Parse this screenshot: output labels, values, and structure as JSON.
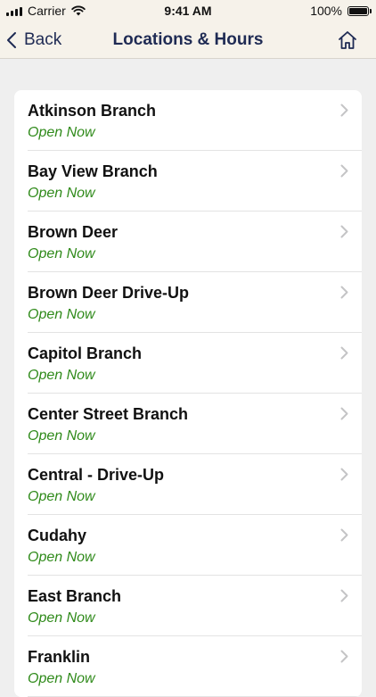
{
  "status_bar": {
    "carrier": "Carrier",
    "time": "9:41 AM",
    "battery": "100%"
  },
  "nav": {
    "back_label": "Back",
    "title": "Locations & Hours"
  },
  "colors": {
    "nav_background": "#f6f2ea",
    "nav_text": "#1f2b54",
    "open_status": "#2f8a1a",
    "page_background": "#efefef"
  },
  "locations": [
    {
      "name": "Atkinson Branch",
      "status": "Open Now"
    },
    {
      "name": "Bay View Branch",
      "status": "Open Now"
    },
    {
      "name": "Brown Deer",
      "status": "Open Now"
    },
    {
      "name": "Brown Deer Drive-Up",
      "status": "Open Now"
    },
    {
      "name": "Capitol Branch",
      "status": "Open Now"
    },
    {
      "name": "Center Street Branch",
      "status": "Open Now"
    },
    {
      "name": "Central - Drive-Up",
      "status": "Open Now"
    },
    {
      "name": "Cudahy",
      "status": "Open Now"
    },
    {
      "name": "East Branch",
      "status": "Open Now"
    },
    {
      "name": "Franklin",
      "status": "Open Now"
    }
  ]
}
